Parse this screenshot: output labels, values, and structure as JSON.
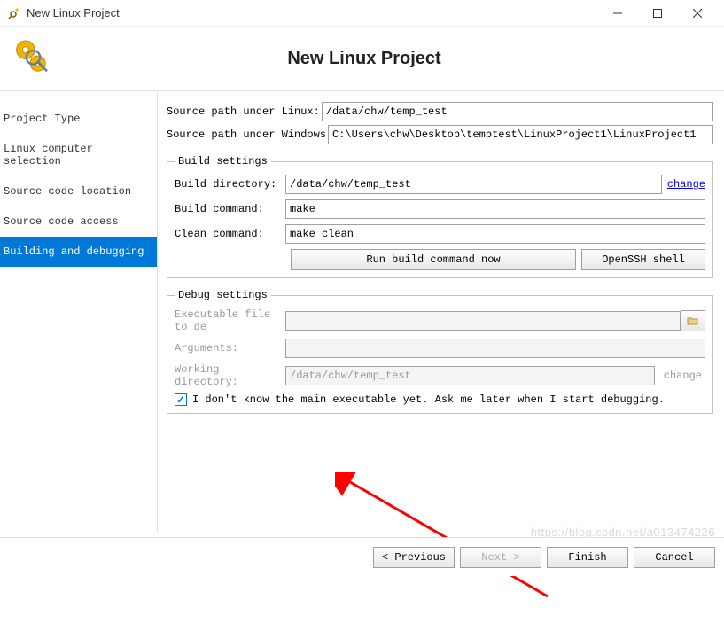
{
  "window": {
    "title": "New Linux Project"
  },
  "header": {
    "title": "New Linux Project"
  },
  "sidebar": {
    "items": [
      {
        "label": "Project Type"
      },
      {
        "label": "Linux computer selection"
      },
      {
        "label": "Source code location"
      },
      {
        "label": "Source code access"
      },
      {
        "label": "Building and debugging"
      }
    ]
  },
  "paths": {
    "linux_label": "Source path under Linux:",
    "linux_value": "/data/chw/temp_test",
    "windows_label": "Source path under Windows",
    "windows_value": "C:\\Users\\chw\\Desktop\\temptest\\LinuxProject1\\LinuxProject1"
  },
  "build": {
    "legend": "Build settings",
    "dir_label": "Build directory:",
    "dir_value": "/data/chw/temp_test",
    "dir_change": "change",
    "cmd_label": "Build command:",
    "cmd_value": "make",
    "clean_label": "Clean command:",
    "clean_value": "make clean",
    "run_btn": "Run build command now",
    "shell_btn": "OpenSSH shell"
  },
  "debug": {
    "legend": "Debug settings",
    "exe_label": "Executable file to de",
    "args_label": "Arguments:",
    "wd_label": "Working directory:",
    "wd_value": "/data/chw/temp_test",
    "wd_change": "change",
    "chk_label": "I don't know the main executable yet. Ask me later when I start debugging."
  },
  "footer": {
    "prev": "< Previous",
    "next": "Next >",
    "finish": "Finish",
    "cancel": "Cancel"
  },
  "watermark": "https://blog.csdn.net/a013474226"
}
